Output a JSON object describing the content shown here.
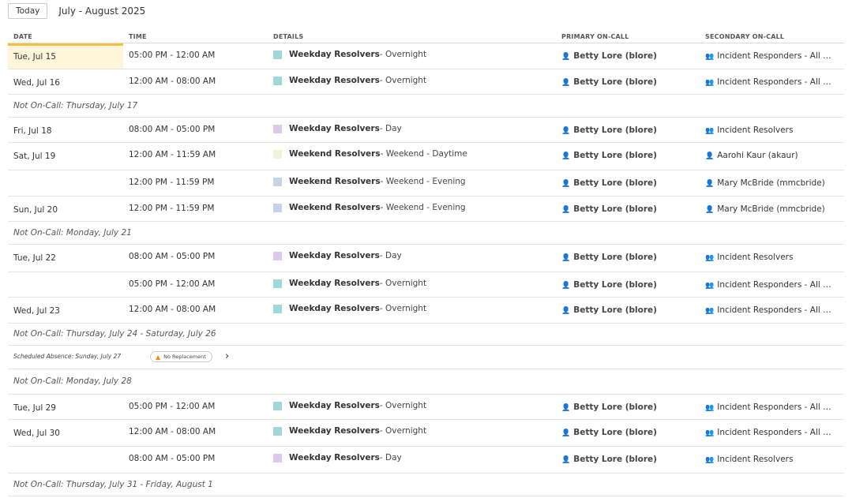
{
  "toolbar": {
    "today_label": "Today",
    "range_label": "July - August 2025"
  },
  "columns": {
    "date": "DATE",
    "time": "TIME",
    "details": "DETAILS",
    "primary": "PRIMARY ON-CALL",
    "secondary": "SECONDARY ON-CALL"
  },
  "colors": {
    "overnight": "#9fd8d8",
    "day": "#dcc8ea",
    "weekend_daytime": "#eef4d8",
    "weekend_evening": "#c5d3e9",
    "current_day_bg": "#fff6da",
    "current_day_border": "#f0c040",
    "warning": "#f28b1e"
  },
  "icons": {
    "person": "person-icon",
    "group": "group-icon",
    "warning": "warning-icon",
    "chevron": "chevron-right-icon"
  },
  "rows": [
    {
      "date": "Tue, Jul 15",
      "time": "05:00 PM - 12:00 AM",
      "schedule": "Weekday Resolvers",
      "rest": " - Overnight",
      "swatch": "overnight",
      "primary": "Betty Lore (blore)",
      "secondary": "Incident Responders - All members",
      "secondary_type": "group"
    },
    {
      "date": "Wed, Jul 16",
      "time": "12:00 AM - 08:00 AM",
      "schedule": "Weekday Resolvers",
      "rest": " - Overnight",
      "swatch": "overnight",
      "primary": "Betty Lore (blore)",
      "secondary": "Incident Responders - All members",
      "secondary_type": "group"
    },
    {
      "gap": "Not On-Call: Thursday, July 17"
    },
    {
      "date": "Fri, Jul 18",
      "time": "08:00 AM - 05:00 PM",
      "schedule": "Weekday Resolvers",
      "rest": " - Day",
      "swatch": "day",
      "primary": "Betty Lore (blore)",
      "secondary": "Incident Resolvers",
      "secondary_type": "group"
    },
    {
      "date": "Sat, Jul 19",
      "time": "12:00 AM - 11:59 AM",
      "schedule": "Weekend Resolvers",
      "rest": " - Weekend - Daytime",
      "swatch": "weekend_daytime",
      "primary": "Betty Lore (blore)",
      "secondary": "Aarohi Kaur (akaur)",
      "secondary_type": "person"
    },
    {
      "date": "",
      "time": "12:00 PM - 11:59 PM",
      "schedule": "Weekend Resolvers",
      "rest": " - Weekend - Evening",
      "swatch": "weekend_evening",
      "primary": "Betty Lore (blore)",
      "secondary": "Mary McBride (mmcbride)",
      "secondary_type": "person"
    },
    {
      "date": "Sun, Jul 20",
      "time": "12:00 PM - 11:59 PM",
      "schedule": "Weekend Resolvers",
      "rest": " - Weekend - Evening",
      "swatch": "weekend_evening",
      "primary": "Betty Lore (blore)",
      "secondary": "Mary McBride (mmcbride)",
      "secondary_type": "person"
    },
    {
      "gap": "Not On-Call: Monday, July 21"
    },
    {
      "date": "Tue, Jul 22",
      "time": "08:00 AM - 05:00 PM",
      "schedule": "Weekday Resolvers",
      "rest": " - Day",
      "swatch": "day",
      "primary": "Betty Lore (blore)",
      "secondary": "Incident Resolvers",
      "secondary_type": "group"
    },
    {
      "date": "",
      "time": "05:00 PM - 12:00 AM",
      "schedule": "Weekday Resolvers",
      "rest": " - Overnight",
      "swatch": "overnight",
      "primary": "Betty Lore (blore)",
      "secondary": "Incident Responders - All members",
      "secondary_type": "group"
    },
    {
      "date": "Wed, Jul 23",
      "time": "12:00 AM - 08:00 AM",
      "schedule": "Weekday Resolvers",
      "rest": " - Overnight",
      "swatch": "overnight",
      "primary": "Betty Lore (blore)",
      "secondary": "Incident Responders - All members",
      "secondary_type": "group"
    },
    {
      "gap": "Not On-Call: Thursday, July 24 - Saturday, July 26"
    },
    {
      "absence": "Scheduled Absence: Sunday, July 27",
      "badge": "No Replacement"
    },
    {
      "gap": "Not On-Call: Monday, July 28"
    },
    {
      "date": "Tue, Jul 29",
      "time": "05:00 PM - 12:00 AM",
      "schedule": "Weekday Resolvers",
      "rest": " - Overnight",
      "swatch": "overnight",
      "primary": "Betty Lore (blore)",
      "secondary": "Incident Responders - All members",
      "secondary_type": "group"
    },
    {
      "date": "Wed, Jul 30",
      "time": "12:00 AM - 08:00 AM",
      "schedule": "Weekday Resolvers",
      "rest": " - Overnight",
      "swatch": "overnight",
      "primary": "Betty Lore (blore)",
      "secondary": "Incident Responders - All members",
      "secondary_type": "group"
    },
    {
      "date": "",
      "time": "08:00 AM - 05:00 PM",
      "schedule": "Weekday Resolvers",
      "rest": " - Day",
      "swatch": "day",
      "primary": "Betty Lore (blore)",
      "secondary": "Incident Resolvers",
      "secondary_type": "group"
    },
    {
      "gap": "Not On-Call: Thursday, July 31 - Friday, August 1"
    }
  ]
}
